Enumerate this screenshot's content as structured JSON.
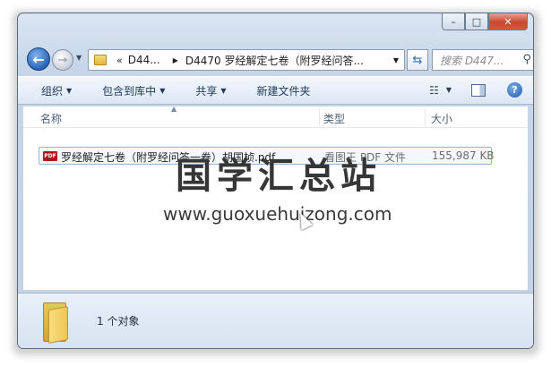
{
  "window": {
    "caption_buttons": {
      "minimize": "–",
      "maximize": "□",
      "close": "✕"
    }
  },
  "nav": {
    "back_glyph": "←",
    "forward_glyph": "→",
    "address_chevron": "«",
    "breadcrumb": [
      "D44...",
      "D4470 罗经解定七卷（附罗经问答..."
    ],
    "search_placeholder": "搜索 D447..."
  },
  "toolbar": {
    "organize": "组织",
    "include_in_library": "包含到库中",
    "share": "共享",
    "new_folder": "新建文件夹"
  },
  "columns": {
    "name": "名称",
    "type": "类型",
    "size": "大小"
  },
  "files": [
    {
      "name": "罗经解定七卷（附罗经问答一卷）胡国桢.pdf",
      "type": "看图王 PDF 文件",
      "size": "155,987 KB",
      "icon": "pdf-file-icon",
      "icon_label": "PDF",
      "icon_color": "#b4151c"
    }
  ],
  "watermark": {
    "title": "国学汇总站",
    "url": "www.guoxuehuizong.com"
  },
  "details": {
    "count_text": "1 个对象"
  }
}
